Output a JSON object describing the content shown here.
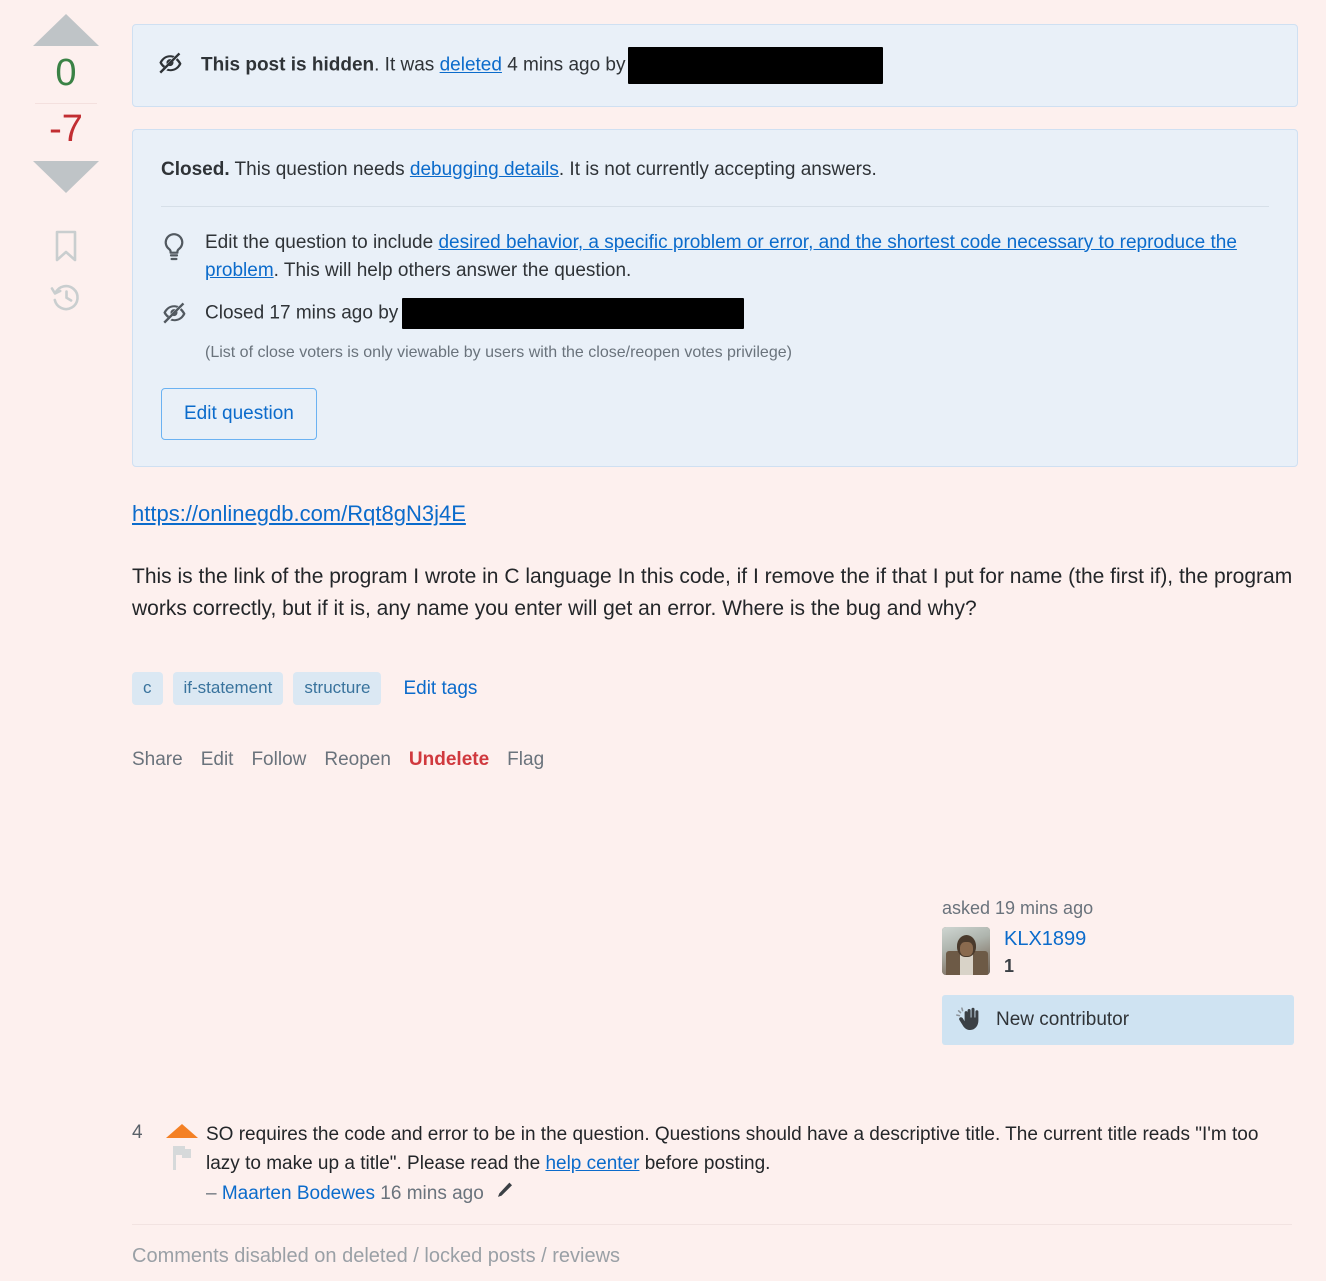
{
  "vote": {
    "up_icon": "vote-up-arrow-icon",
    "accepted_count": "0",
    "score": "-7",
    "down_icon": "vote-down-arrow-icon",
    "bookmark_icon": "bookmark-icon",
    "history_icon": "history-icon"
  },
  "hidden_notice": {
    "icon": "eye-slash-icon",
    "bold": "This post is hidden",
    "after_bold": ". It was ",
    "link": "deleted",
    "tail": " 4 mins ago by",
    "redacted_user": ""
  },
  "closed_notice": {
    "headline_bold": "Closed.",
    "headline_pre": " This question needs ",
    "headline_link": "debugging details",
    "headline_post": ". It is not currently accepting answers.",
    "reason_icon": "lightbulb-icon",
    "reason_pre": "Edit the question to include ",
    "reason_link": "desired behavior, a specific problem or error, and the shortest code necessary to reproduce the problem",
    "reason_post": ". This will help others answer the question.",
    "closed_icon": "eye-slash-icon",
    "closed_by_pre": "Closed 17 mins ago by",
    "closed_by_redacted": "",
    "voters_note": "(List of close voters is only viewable by users with the close/reopen votes privilege)",
    "edit_button": "Edit question"
  },
  "post_body": {
    "link_text": "https://onlinegdb.com/Rqt8gN3j4E",
    "paragraph": "This is the link of the program I wrote in C language In this code, if I remove the if that I put for name (the first if), the program works correctly, but if it is, any name you enter will get an error. Where is the bug and why?"
  },
  "tags": {
    "items": [
      "c",
      "if-statement",
      "structure"
    ],
    "edit_tags": "Edit tags"
  },
  "actions": {
    "items": [
      {
        "label": "Share",
        "style": "normal"
      },
      {
        "label": "Edit",
        "style": "normal"
      },
      {
        "label": "Follow",
        "style": "normal"
      },
      {
        "label": "Reopen",
        "style": "normal"
      },
      {
        "label": "Undelete",
        "style": "danger"
      },
      {
        "label": "Flag",
        "style": "normal"
      }
    ]
  },
  "usercard": {
    "asked": "asked 19 mins ago",
    "avatar": "user-avatar",
    "username": "KLX1899",
    "reputation": "1",
    "badge_icon": "waving-hand-icon",
    "badge_label": "New contributor"
  },
  "comments": {
    "items": [
      {
        "score": "4",
        "upvote_icon": "comment-upvote-icon",
        "flag_icon": "flag-icon",
        "text_1": "SO requires the code and error to be in the question. Questions should have a descriptive title. The current title reads \"I'm too lazy to make up a title\". Please read the ",
        "link": "help center",
        "text_2": " before posting.",
        "dash": "– ",
        "author": "Maarten Bodewes",
        "timestamp": "16 mins ago",
        "edit_icon": "pencil-icon"
      }
    ],
    "disabled_note": "Comments disabled on deleted / locked posts / reviews"
  },
  "colors": {
    "page_bg": "#fdf0ee",
    "notice_bg": "#e9f0f8",
    "notice_border": "#cfe0f2",
    "link": "#0b6bcb",
    "tag_bg": "#dbe8f3",
    "tag_text": "#39739d",
    "danger": "#d0393e",
    "accepted_green": "#3a8245",
    "negative_red": "#c22e32",
    "comment_upvote_orange": "#f48024",
    "badge_bg": "#cfe3f2"
  }
}
